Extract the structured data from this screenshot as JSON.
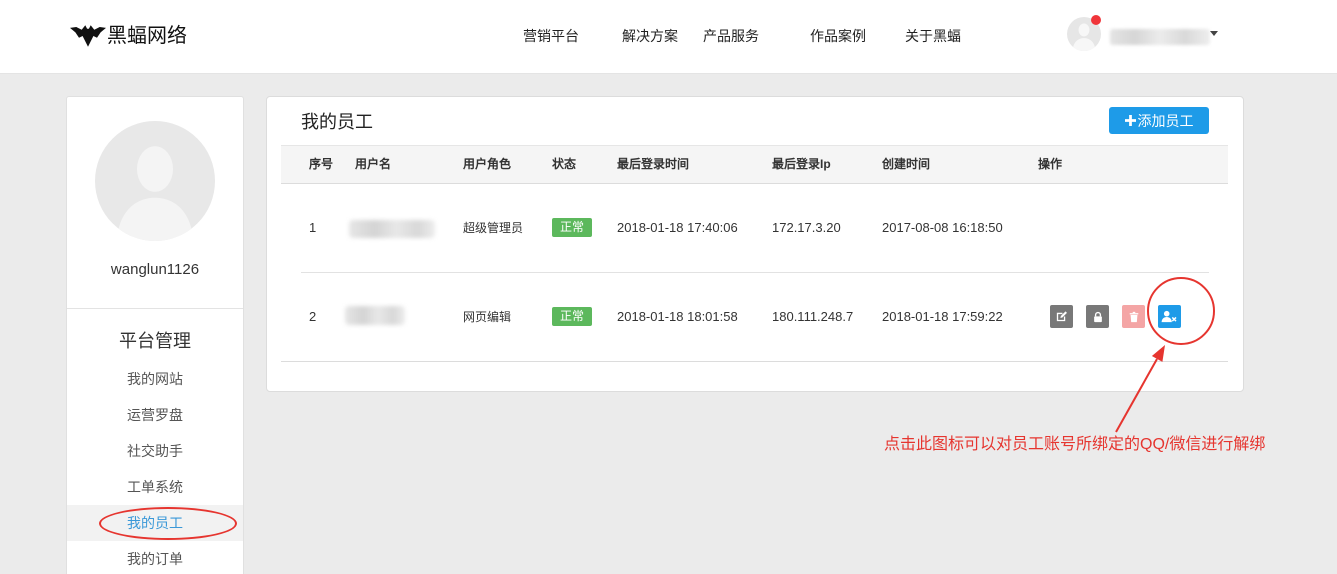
{
  "colors": {
    "page_bg": "#ebebeb",
    "accent": "#1e9be8",
    "active_menu_text": "#3a98d8",
    "status_ok": "#5cb85c",
    "action_neutral": "#787878",
    "action_delete": "#f4a5a5",
    "annotation_red": "#e6352f"
  },
  "header": {
    "logo_icon": "bat-logo-icon",
    "logo_text": "黑蝠网络",
    "nav": [
      {
        "label": "营销平台"
      },
      {
        "label": "解决方案"
      },
      {
        "label": "产品服务"
      },
      {
        "label": "作品案例"
      },
      {
        "label": "关于黑蝠"
      }
    ],
    "user_menu": {
      "avatar_icon": "user-avatar-icon",
      "has_notification_dot": true,
      "dropdown_icon": "caret-down-icon"
    }
  },
  "sidebar": {
    "username": "wanglun1126",
    "section_title": "平台管理",
    "items": [
      {
        "label": "我的网站",
        "active": false
      },
      {
        "label": "运营罗盘",
        "active": false
      },
      {
        "label": "社交助手",
        "active": false
      },
      {
        "label": "工单系统",
        "active": false
      },
      {
        "label": "我的员工",
        "active": true
      },
      {
        "label": "我的订单",
        "active": false
      }
    ]
  },
  "main": {
    "title": "我的员工",
    "add_button": {
      "icon": "plus-icon",
      "label": "添加员工"
    },
    "table": {
      "columns": [
        "序号",
        "用户名",
        "用户角色",
        "状态",
        "最后登录时间",
        "最后登录Ip",
        "创建时间",
        "操作"
      ],
      "rows": [
        {
          "index": "1",
          "username_blurred": true,
          "role": "超级管理员",
          "status": "正常",
          "last_login_time": "2018-01-18 17:40:06",
          "last_login_ip": "172.17.3.20",
          "created_at": "2017-08-08 16:18:50",
          "actions": []
        },
        {
          "index": "2",
          "username_blurred": true,
          "role": "网页编辑",
          "status": "正常",
          "last_login_time": "2018-01-18 18:01:58",
          "last_login_ip": "180.111.248.7",
          "created_at": "2018-01-18 17:59:22",
          "actions": [
            {
              "icon": "edit-icon"
            },
            {
              "icon": "lock-icon"
            },
            {
              "icon": "trash-icon"
            },
            {
              "icon": "user-unbind-icon"
            }
          ]
        }
      ]
    }
  },
  "annotation": {
    "text": "点击此图标可以对员工账号所绑定的QQ/微信进行解绑"
  }
}
